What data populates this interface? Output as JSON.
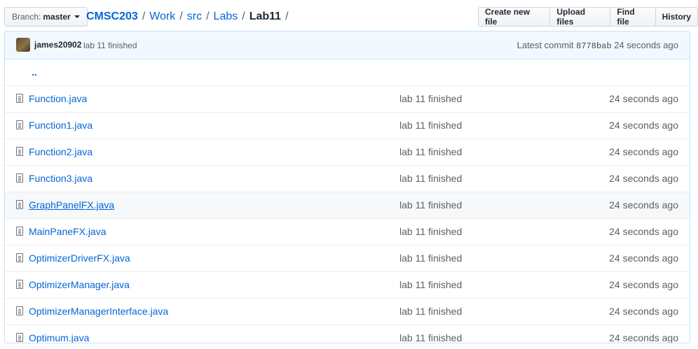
{
  "branch": {
    "label": "Branch:",
    "value": "master"
  },
  "breadcrumb": {
    "root": "CMSC203",
    "parts": [
      "Work",
      "src",
      "Labs"
    ],
    "current": "Lab11",
    "separator": "/"
  },
  "actions": {
    "create": "Create new file",
    "upload": "Upload files",
    "find": "Find file",
    "history": "History"
  },
  "commit": {
    "author": "james20902",
    "message": "lab 11 finished",
    "latest_label": "Latest commit",
    "sha": "8778bab",
    "age": "24 seconds ago"
  },
  "parent_link": "..",
  "files": [
    {
      "name": "Function.java",
      "message": "lab 11 finished",
      "age": "24 seconds ago"
    },
    {
      "name": "Function1.java",
      "message": "lab 11 finished",
      "age": "24 seconds ago"
    },
    {
      "name": "Function2.java",
      "message": "lab 11 finished",
      "age": "24 seconds ago"
    },
    {
      "name": "Function3.java",
      "message": "lab 11 finished",
      "age": "24 seconds ago"
    },
    {
      "name": "GraphPanelFX.java",
      "message": "lab 11 finished",
      "age": "24 seconds ago"
    },
    {
      "name": "MainPaneFX.java",
      "message": "lab 11 finished",
      "age": "24 seconds ago"
    },
    {
      "name": "OptimizerDriverFX.java",
      "message": "lab 11 finished",
      "age": "24 seconds ago"
    },
    {
      "name": "OptimizerManager.java",
      "message": "lab 11 finished",
      "age": "24 seconds ago"
    },
    {
      "name": "OptimizerManagerInterface.java",
      "message": "lab 11 finished",
      "age": "24 seconds ago"
    },
    {
      "name": "Optimum.java",
      "message": "lab 11 finished",
      "age": "24 seconds ago"
    }
  ],
  "colors": {
    "link": "#0366d6",
    "commit_bar": "#f1f8ff",
    "border": "#c8e1ff"
  }
}
